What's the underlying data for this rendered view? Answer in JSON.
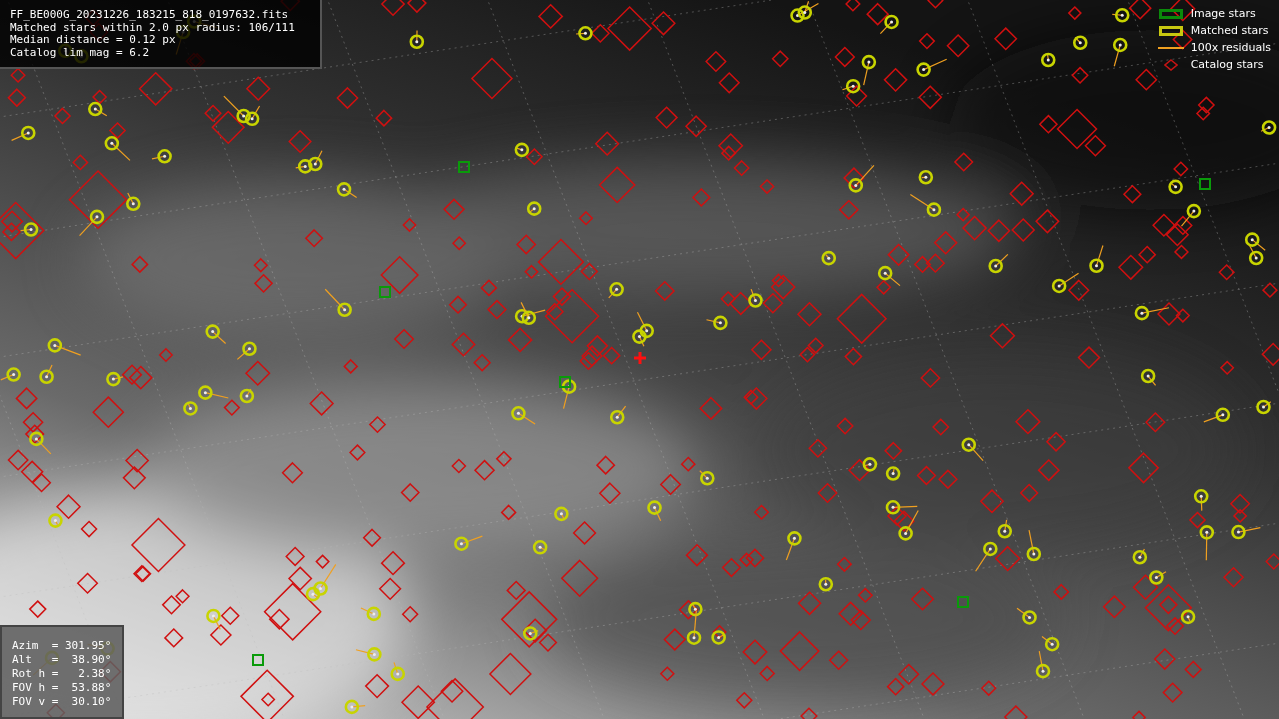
{
  "info": {
    "lines": [
      "FF_BE000G_20231226_183215_818_0197632.fits",
      "Matched stars within 2.0 px radius: 106/111",
      "Median distance = 0.12 px",
      "Catalog lim mag = 6.2"
    ]
  },
  "legend": [
    {
      "kind": "rect",
      "color": "#0a8a0a",
      "label": "Image stars"
    },
    {
      "kind": "rect",
      "color": "#c8c810",
      "label": "Matched stars"
    },
    {
      "kind": "line",
      "color": "#f0a020",
      "label": "100x residuals"
    },
    {
      "kind": "diamond",
      "color": "#c81414",
      "label": "Catalog stars"
    }
  ],
  "params": {
    "lines": [
      "Azim  = 301.95°",
      "Alt   =  38.90°",
      "Rot h =   2.38°",
      "FOV h =  53.88°",
      "FOV v =  30.10°"
    ]
  }
}
